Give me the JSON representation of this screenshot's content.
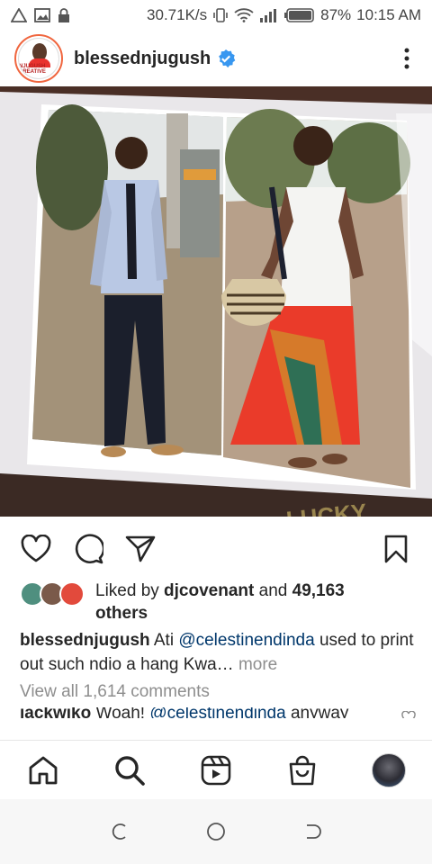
{
  "status_bar": {
    "speed": "30.71K/s",
    "battery": "87%",
    "time": "10:15 AM"
  },
  "post": {
    "username": "blessednjugush",
    "avatar_text": "NJUGUSH CREATIVE",
    "image_overlay_text": "LUCKY"
  },
  "likes": {
    "prefix": "Liked by ",
    "user": "djcovenant",
    "middle": " and ",
    "count": "49,163",
    "suffix": "others"
  },
  "caption": {
    "username": "blessednjugush",
    "text_before": " Ati ",
    "mention": "@celestinendinda",
    "text_after": " used to print out such ndio a hang Kwa",
    "ellipsis": "…",
    "more": " more"
  },
  "view_comments": "View all 1,614 comments",
  "comment_peek": {
    "username": "jackwiko",
    "text": " Woah! ",
    "mention": "@celestinendinda",
    "rest": " anyway"
  },
  "colors": {
    "mention": "#00376b",
    "verified": "#3897f0",
    "muted": "#8e8e8e"
  },
  "icons": {
    "like": "heart-icon",
    "comment": "comment-icon",
    "share": "send-icon",
    "save": "bookmark-icon",
    "home": "home-icon",
    "search": "search-icon",
    "reels": "reels-icon",
    "shop": "shop-icon"
  }
}
